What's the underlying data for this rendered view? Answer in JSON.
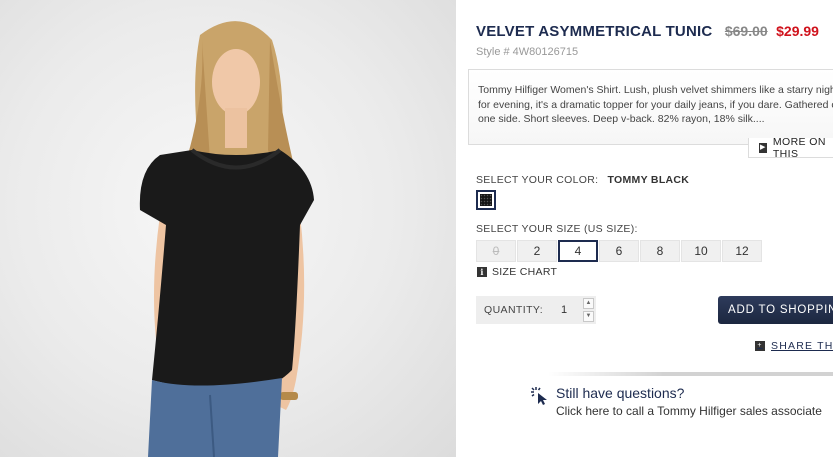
{
  "product": {
    "title": "VELVET ASYMMETRICAL TUNIC",
    "old_price": "$69.00",
    "new_price": "$29.99",
    "style": "Style # 4W80126715",
    "description": "Tommy Hilfiger Women's Shirt. Lush, plush velvet shimmers like a starry night\nfor evening, it's a dramatic topper for your daily jeans, if you dare. Gathered on\none side. Short sleeves. Deep v-back. 82% rayon, 18% silk....",
    "more_label": "MORE ON THIS"
  },
  "color": {
    "label": "SELECT YOUR COLOR:",
    "selected": "TOMMY BLACK",
    "swatch_color": "#151515",
    "swatch_icon": "velvet-swatch"
  },
  "size": {
    "label": "SELECT YOUR SIZE (US SIZE):",
    "options": [
      "0",
      "2",
      "4",
      "6",
      "8",
      "10",
      "12"
    ],
    "selected": "4",
    "unavailable": [
      "0"
    ],
    "chart_label": "SIZE CHART"
  },
  "quantity": {
    "label": "QUANTITY:",
    "value": "1",
    "up_icon": "chevron-up-icon",
    "down_icon": "chevron-down-icon"
  },
  "actions": {
    "add_label": "ADD TO SHOPPING BAG",
    "share_label": "SHARE THIS"
  },
  "questions": {
    "title": "Still have questions?",
    "subtitle": "Click here to call a Tommy Hilfiger sales associate"
  },
  "colors": {
    "brand_navy": "#1d2b4f",
    "sale_red": "#d0121c"
  }
}
